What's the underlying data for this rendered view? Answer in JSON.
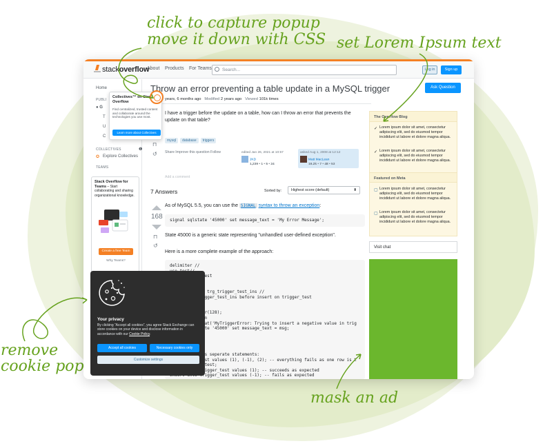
{
  "annotations": {
    "capture_popup": "click to capture popup",
    "move_down": "move it down with CSS",
    "lorem": "set Lorem Ipsum text",
    "remove": "remove",
    "cookie_popup": "cookie popup",
    "mask": "mask an ad"
  },
  "colors": {
    "accent": "#66a21e",
    "so_orange": "#f48024",
    "so_blue": "#0a95ff",
    "ad_green": "#6bb72d"
  },
  "topbar": {
    "logo_light": "stack",
    "logo_bold": "overflow",
    "nav": [
      "About",
      "Products",
      "For Teams"
    ],
    "search_placeholder": "Search...",
    "login": "Log in",
    "signup": "Sign up"
  },
  "sidebar": {
    "home": "Home",
    "public": "PUBLI",
    "g": "G",
    "t": "T",
    "u": "U",
    "c": "C",
    "collectives_cap": "COLLECTIVES",
    "explore": "Explore Collectives",
    "teams_cap": "TEAMS",
    "teams_title": "Stack Overflow for Teams",
    "teams_desc": "– Start collaborating and sharing organizational knowledge.",
    "teams_btn": "Create a free Team",
    "why": "Why Teams?"
  },
  "popover": {
    "title": "Collectives™ on Stack Overflow",
    "desc": "Find centralized, trusted content and collaborate around the technologies you use most.",
    "button": "Learn more about Collectives"
  },
  "question": {
    "title": "Throw an error preventing a table update in a MySQL trigger",
    "ask": "Ask Question",
    "asked": "years, 6 months ago",
    "modified_label": "Modified",
    "modified": "2 years ago",
    "viewed_label": "Viewed",
    "viewed": "101k times",
    "body": "I have a trigger before the update on a table, how can I throw an error that prevents the update on that table?",
    "tags": [
      "mysql",
      "database",
      "triggers"
    ],
    "share": "Share  Improve this question  Follow",
    "edited": "edited Jan 26, 2021 at 10:57",
    "editor": "JKD",
    "editor_rep": "1,239 • 1 • 5 • 24",
    "asked_card": "asked Aug 1, 2008 at 12:12",
    "asker": "Matt MacLean",
    "asker_rep": "19.2k • 7 • 48 • 53",
    "comment": "Add a comment"
  },
  "answers": {
    "count_label": "7 Answers",
    "sort_label": "Sorted by:",
    "sort_value": "Highest score (default)",
    "score": "168",
    "p1_a": "As of MySQL 5.5, you can use the ",
    "p1_link1": "SIGNAL",
    "p1_link2": "syntax to throw an exception",
    "p1_b": ":",
    "code1": "signal sqlstate '45000' set message_text = 'My Error Message';",
    "p2": "State 45000 is a generic state representing \"unhandled user-defined exception\".",
    "p3": "Here is a more complete example of the approach:",
    "code2": [
      "delimiter //",
      "use test//",
      "           r_test",
      "",
      "",
      "           sts trg_trigger_test_ins //",
      "           trigger_test_ins before insert on trigger_test",
      "",
      "",
      "           char(128);",
      "           then",
      "           oncat('MyTriggerError: Trying to insert a negative value in trig",
      "           state '45000' set message_text = msg;",
      "",
      "",
      "",
      "",
      "           g as seperate statements:",
      "           _test values (1), (-1), (2); -- everything fails as one row is t",
      "           er_test;",
      "insert into trigger_test values (1); -- succeeds as expected",
      "insert into trigger_test values (-1); -- fails as expected"
    ]
  },
  "blog": {
    "header": "The Overflow Blog",
    "items": [
      "Lorem ipsum dolor sit amet, consectetur adipiscing elit, sed do eiusmod tempor incididunt ut labore et dolore magna aliqua.",
      "Lorem ipsum dolor sit amet, consectetur adipiscing elit, sed do eiusmod tempor incididunt ut labore et dolore magna aliqua."
    ],
    "meta_header": "Featured on Meta",
    "meta_items": [
      "Lorem ipsum dolor sit amet, consectetur adipiscing elit, sed do eiusmod tempor incididunt ut labore et dolore magna aliqua.",
      "Lorem ipsum dolor sit amet, consectetur adipiscing elit, sed do eiusmod tempor incididunt ut labore et dolore magna aliqua."
    ],
    "visit_chat": "Visit chat"
  },
  "cookie": {
    "title": "Your privacy",
    "text_a": "By clicking “Accept all cookies”, you agree Stack Exchange can store cookies on your device and disclose information in accordance with our ",
    "policy": "Cookie Policy",
    "text_b": ".",
    "accept": "Accept all cookies",
    "necessary": "Necessary cookies only",
    "customize": "Customize settings"
  }
}
